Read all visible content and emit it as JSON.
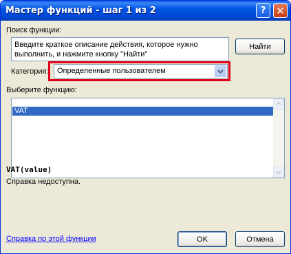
{
  "window": {
    "title": "Мастер функций - шаг 1 из 2",
    "help_glyph": "?",
    "close_glyph": "✕"
  },
  "search": {
    "label": "Поиск функции:",
    "description": "Введите краткое описание действия, которое нужно выполнить, и нажмите кнопку \"Найти\"",
    "find_button": "Найти"
  },
  "category": {
    "label": "Категория:",
    "selected": "Определенные пользователем",
    "highlight_color": "#e3001b"
  },
  "function_list": {
    "label": "Выберите функцию:",
    "items": [
      "VAT"
    ],
    "selected_index": 0
  },
  "function_info": {
    "signature": "VAT(value)",
    "help_text": "Справка недоступна."
  },
  "footer": {
    "help_link": "Справка по этой функции",
    "ok_button": "OK",
    "cancel_button": "Отмена"
  },
  "colors": {
    "title_bar": "#0054e3",
    "dialog_bg": "#ece9d8",
    "selection": "#316ac5",
    "link": "#0000ff"
  }
}
